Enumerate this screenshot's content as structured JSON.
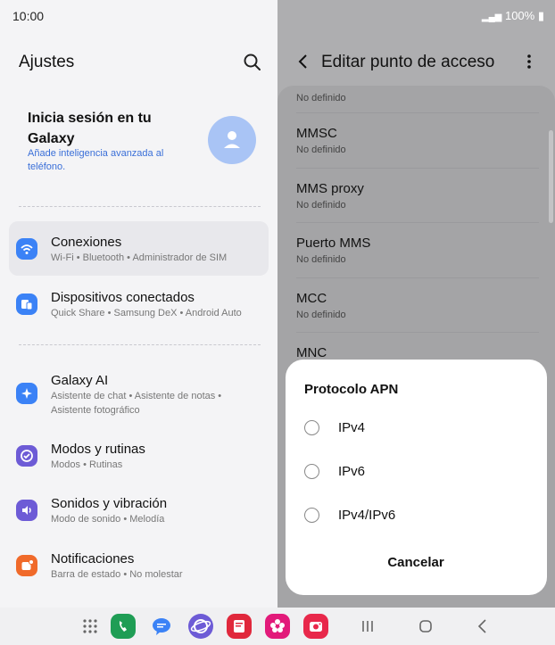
{
  "status": {
    "time": "10:00",
    "battery": "100%"
  },
  "left": {
    "title": "Ajustes",
    "profile": {
      "title": "Inicia sesión en tu Galaxy",
      "subtitle": "Añade inteligencia avanzada al teléfono."
    },
    "items": [
      {
        "title": "Conexiones",
        "subtitle": "Wi-Fi  •  Bluetooth  •  Administrador de SIM",
        "icon": "wifi-icon",
        "color": "#3b82f6"
      },
      {
        "title": "Dispositivos conectados",
        "subtitle": "Quick Share  •  Samsung DeX  •  Android Auto",
        "icon": "devices-icon",
        "color": "#3b82f6"
      },
      {
        "title": "Galaxy AI",
        "subtitle": "Asistente de chat  •  Asistente de notas  •  Asistente fotográfico",
        "icon": "sparkle-icon",
        "color": "#3b82f6"
      },
      {
        "title": "Modos y rutinas",
        "subtitle": "Modos  •  Rutinas",
        "icon": "check-circle-icon",
        "color": "#6d5bd6"
      },
      {
        "title": "Sonidos y vibración",
        "subtitle": "Modo de sonido  •  Melodía",
        "icon": "volume-icon",
        "color": "#6d5bd6"
      },
      {
        "title": "Notificaciones",
        "subtitle": "Barra de estado  •  No molestar",
        "icon": "bell-icon",
        "color": "#f06a2a"
      }
    ]
  },
  "right": {
    "title": "Editar punto de acceso",
    "top_value": "No definido",
    "rows": [
      {
        "label": "MMSC",
        "value": "No definido"
      },
      {
        "label": "MMS proxy",
        "value": "No definido"
      },
      {
        "label": "Puerto MMS",
        "value": "No definido"
      },
      {
        "label": "MCC",
        "value": "No definido"
      },
      {
        "label": "MNC",
        "value": ""
      }
    ]
  },
  "dialog": {
    "title": "Protocolo APN",
    "options": [
      "IPv4",
      "IPv6",
      "IPv4/IPv6"
    ],
    "cancel": "Cancelar"
  },
  "taskbar": {
    "apps": [
      "apps-grid-icon",
      "phone-icon",
      "messages-icon",
      "internet-icon",
      "notes-icon",
      "gallery-icon",
      "camera-icon"
    ],
    "nav": [
      "recents-icon",
      "home-icon",
      "back-icon"
    ]
  }
}
